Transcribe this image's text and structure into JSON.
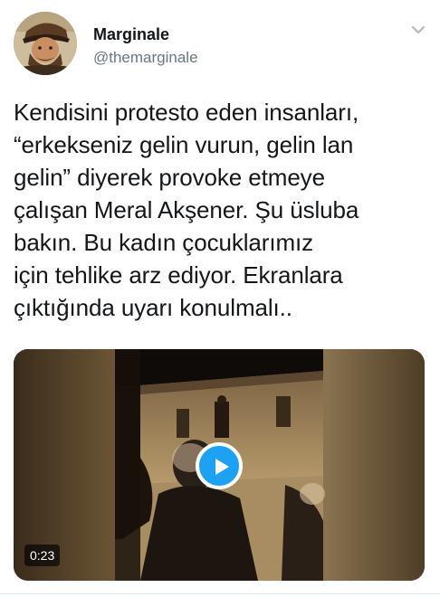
{
  "tweet": {
    "author": {
      "display_name": "Marginale",
      "handle": "@themarginale",
      "avatar_icon": "profile-avatar-illustration"
    },
    "menu_icon": "chevron-down-icon",
    "text": "Kendisini protesto eden insanları,\n“erkekseniz gelin vurun, gelin lan\ngelin” diyerek provoke etmeye\nçalışan Meral Akşener. Şu üsluba\nbakın. Bu kadın çocuklarımız\niçin tehlike arz ediyor. Ekranlara\nçıktığında uyarı konulmalı..",
    "video": {
      "duration": "0:23",
      "play_icon": "play-icon",
      "accent_color": "#1da1f2"
    }
  },
  "colors": {
    "text_primary": "#14171a",
    "text_secondary": "#657786",
    "accent": "#1da1f2"
  }
}
